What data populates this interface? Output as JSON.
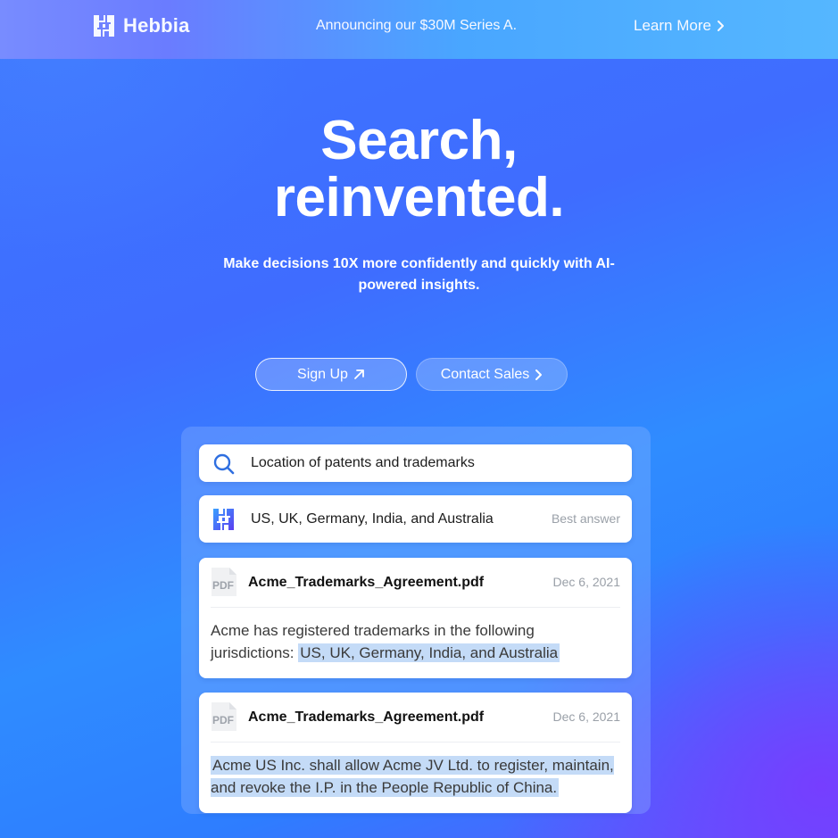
{
  "topbar": {
    "logo_text": "Hebbia",
    "announcement": "Announcing our $30M Series A.",
    "learn_more": "Learn More"
  },
  "hero": {
    "title_line1": "Search,",
    "title_line2": "reinvented.",
    "subtitle": "Make decisions 10X more confidently and quickly with AI-powered insights.",
    "signup_label": "Sign Up",
    "contact_label": "Contact Sales"
  },
  "demo": {
    "search_query": "Location of patents and trademarks",
    "answer": "US, UK, Germany, India, and Australia",
    "answer_badge": "Best answer",
    "results": [
      {
        "icon_label": "PDF",
        "filename": "Acme_Trademarks_Agreement.pdf",
        "date": "Dec 6, 2021",
        "text_before": "Acme has registered trademarks in the following jurisdictions: ",
        "text_highlight": "US, UK, Germany, India, and Australia"
      },
      {
        "icon_label": "PDF",
        "filename": "Acme_Trademarks_Agreement.pdf",
        "date": "Dec 6, 2021",
        "text_before": "",
        "text_highlight": "Acme US Inc. shall allow Acme JV Ltd. to register, maintain, and revoke the I.P. in the People Republic of China. "
      }
    ]
  },
  "colors": {
    "highlight": "#c4dbf7",
    "accent_blue": "#2f6fe0",
    "muted_text": "#9aa0a8"
  },
  "icons": {
    "logo": "hebbia-logo-icon",
    "search": "search-icon",
    "arrow_up_right": "arrow-up-right-icon",
    "chevron_right": "chevron-right-icon",
    "pdf": "pdf-file-icon"
  }
}
